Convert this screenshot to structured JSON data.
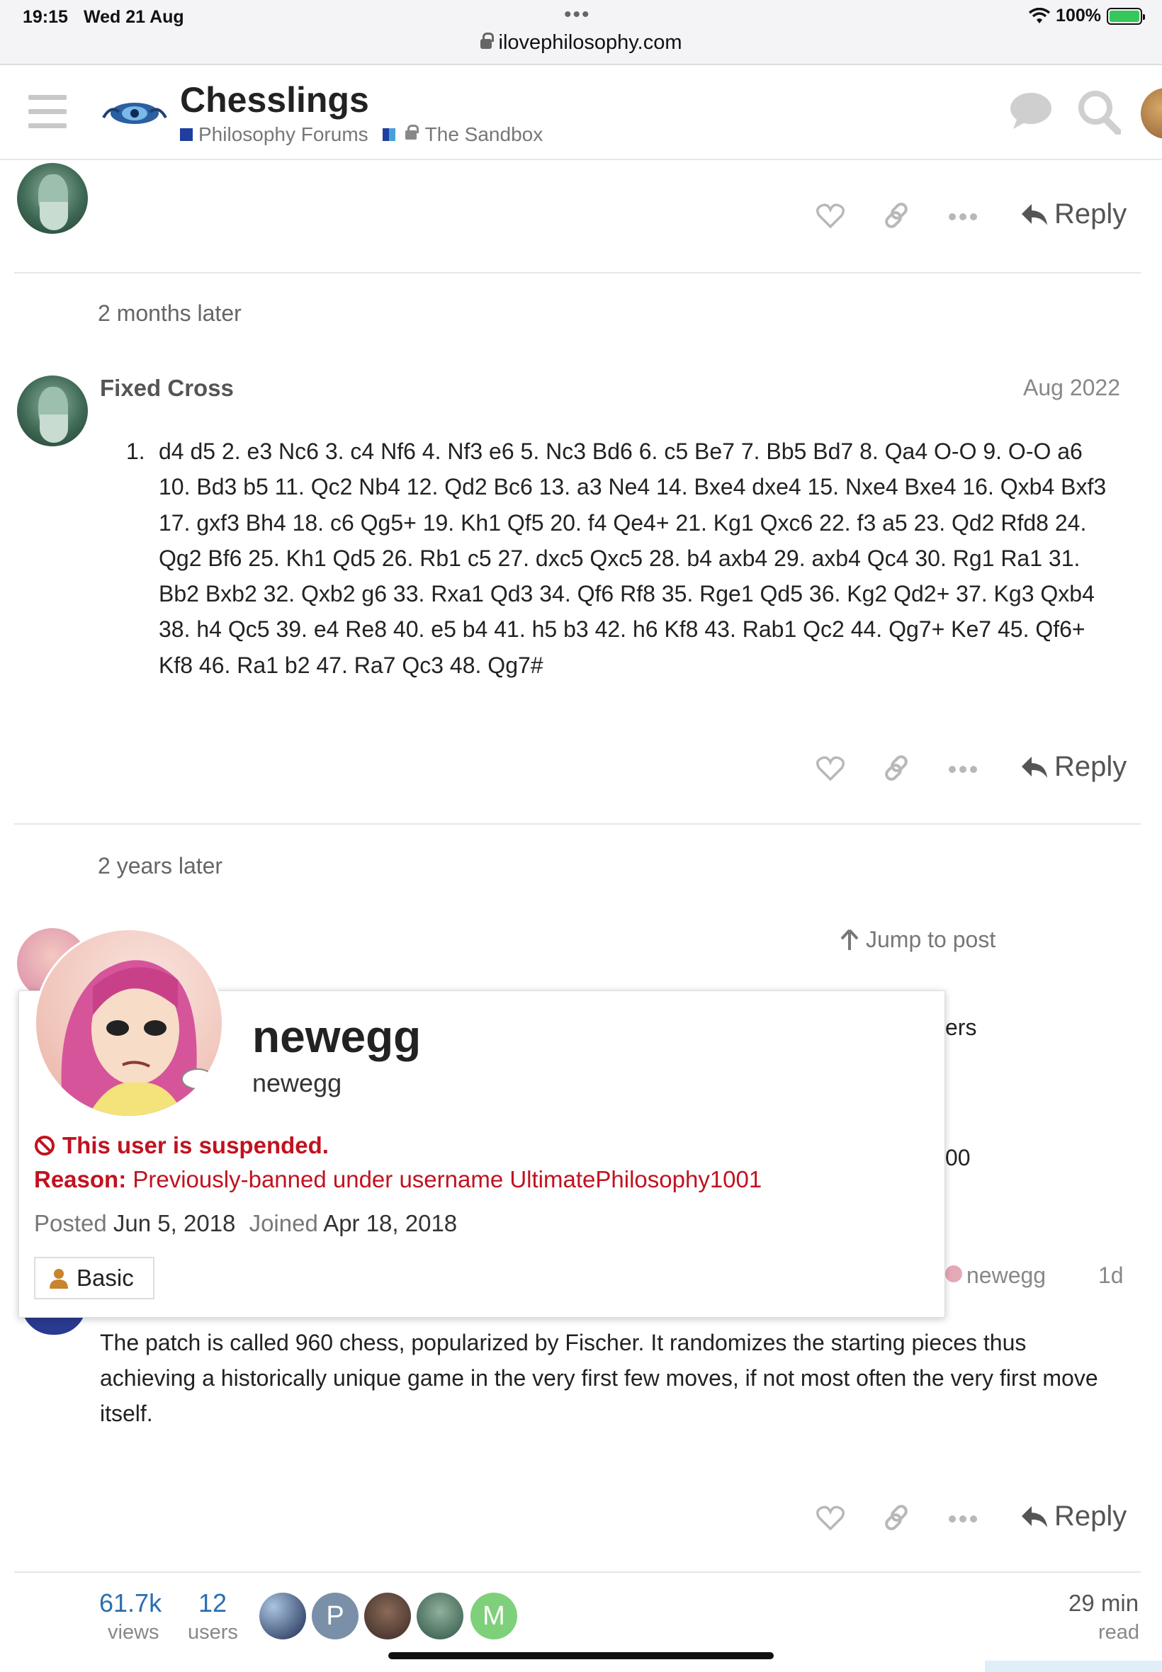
{
  "status_bar": {
    "time": "19:15",
    "date": "Wed 21 Aug",
    "dots": "•••",
    "url": "ilovephilosophy.com",
    "battery": "100%"
  },
  "header": {
    "title": "Chesslings",
    "breadcrumbs": [
      "Philosophy Forums",
      "The Sandbox"
    ],
    "icons": [
      "menu-icon",
      "site-logo",
      "chat-icon",
      "search-icon",
      "user-avatar"
    ]
  },
  "actions": {
    "reply_label": "Reply"
  },
  "gaps": [
    "2 months later",
    "2 years later"
  ],
  "post_fixed_cross": {
    "username": "Fixed Cross",
    "date": "Aug 2022",
    "list_number": "1.",
    "moves": "d4 d5 2. e3 Nc6 3. c4 Nf6 4. Nf3 e6 5. Nc3 Bd6 6. c5 Be7 7. Bb5 Bd7 8. Qa4 O-O 9. O-O a6 10. Bd3 b5 11. Qc2 Nb4 12. Qd2 Bc6 13. a3 Ne4 14. Bxe4 dxe4 15. Nxe4 Bxe4 16. Qxb4 Bxf3 17. gxf3 Bh4 18. c6 Qg5+ 19. Kh1 Qf5 20. f4 Qe4+ 21. Kg1 Qxc6 22. f3 a5 23. Qd2 Rfd8 24. Qg2 Bf6 25. Kh1 Qd5 26. Rb1 c5 27. dxc5 Qxc5 28. b4 axb4 29. axb4 Qc4 30. Rg1 Ra1 31. Bb2 Bxb2 32. Qxb2 g6 33. Rxa1 Qd3 34. Qf6 Rf8 35. Rge1 Qd5 36. Kg2 Qd2+ 37. Kg3 Qxb4 38. h4 Qc5 39. e4 Re8 40. e5 b4 41. h5 b3 42. h6 Kf8 43. Rab1 Qc2 44. Qg7+ Ke7 45. Qf6+ Kf8 46. Ra1 b2 47. Ra7 Qc3 48. Qg7#"
  },
  "post_newegg": {
    "jump_to_post": "Jump to post",
    "obscured_fragment_1": "ers",
    "obscured_fragment_2": "00",
    "reply_to_user": "newegg",
    "age": "1d",
    "body": "The patch is called 960 chess, popularized by Fischer. It randomizes the starting pieces thus achieving a historically unique game in the very first few moves, if not most often the very first move itself."
  },
  "user_card": {
    "display_name": "newegg",
    "username": "newegg",
    "suspended_text": "This user is suspended.",
    "reason_label": "Reason:",
    "reason_text": "Previously-banned under username UltimatePhilosophy1001",
    "posted_label": "Posted",
    "posted_value": "Jun 5, 2018",
    "joined_label": "Joined",
    "joined_value": "Apr 18, 2018",
    "trust_level": "Basic"
  },
  "footer": {
    "views_count": "61.7k",
    "views_label": "views",
    "users_count": "12",
    "users_label": "users",
    "participants": [
      "",
      "P",
      "",
      "",
      "M"
    ],
    "read_time": "29 min",
    "read_label": "read"
  },
  "colors": {
    "link": "#2a6fb0",
    "danger": "#c1121f",
    "brand": "#1e3fa0"
  }
}
